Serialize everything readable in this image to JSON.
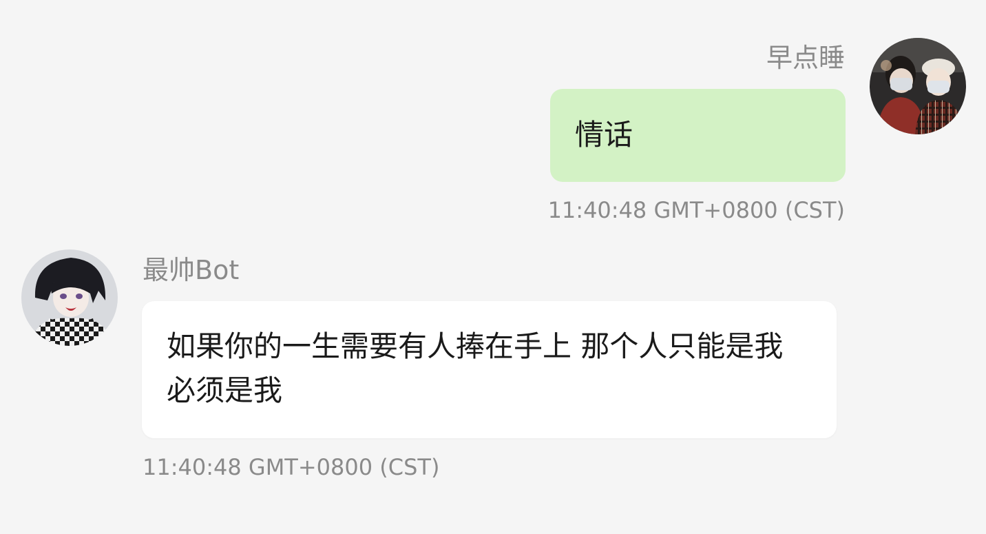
{
  "conversation": {
    "messages": [
      {
        "direction": "outgoing",
        "sender": "早点睡",
        "text": "情话",
        "time": "11:40:48 GMT+0800 (CST)",
        "avatar": "user-avatar"
      },
      {
        "direction": "incoming",
        "sender": "最帅Bot",
        "text": "如果你的一生需要有人捧在手上 那个人只能是我 必须是我",
        "time": "11:40:48 GMT+0800 (CST)",
        "avatar": "bot-avatar"
      }
    ]
  },
  "colors": {
    "background": "#f5f5f5",
    "outgoing_bubble": "#d3f2c5",
    "incoming_bubble": "#ffffff",
    "meta_text": "#8a8a8a",
    "message_text": "#1a1a1a"
  }
}
